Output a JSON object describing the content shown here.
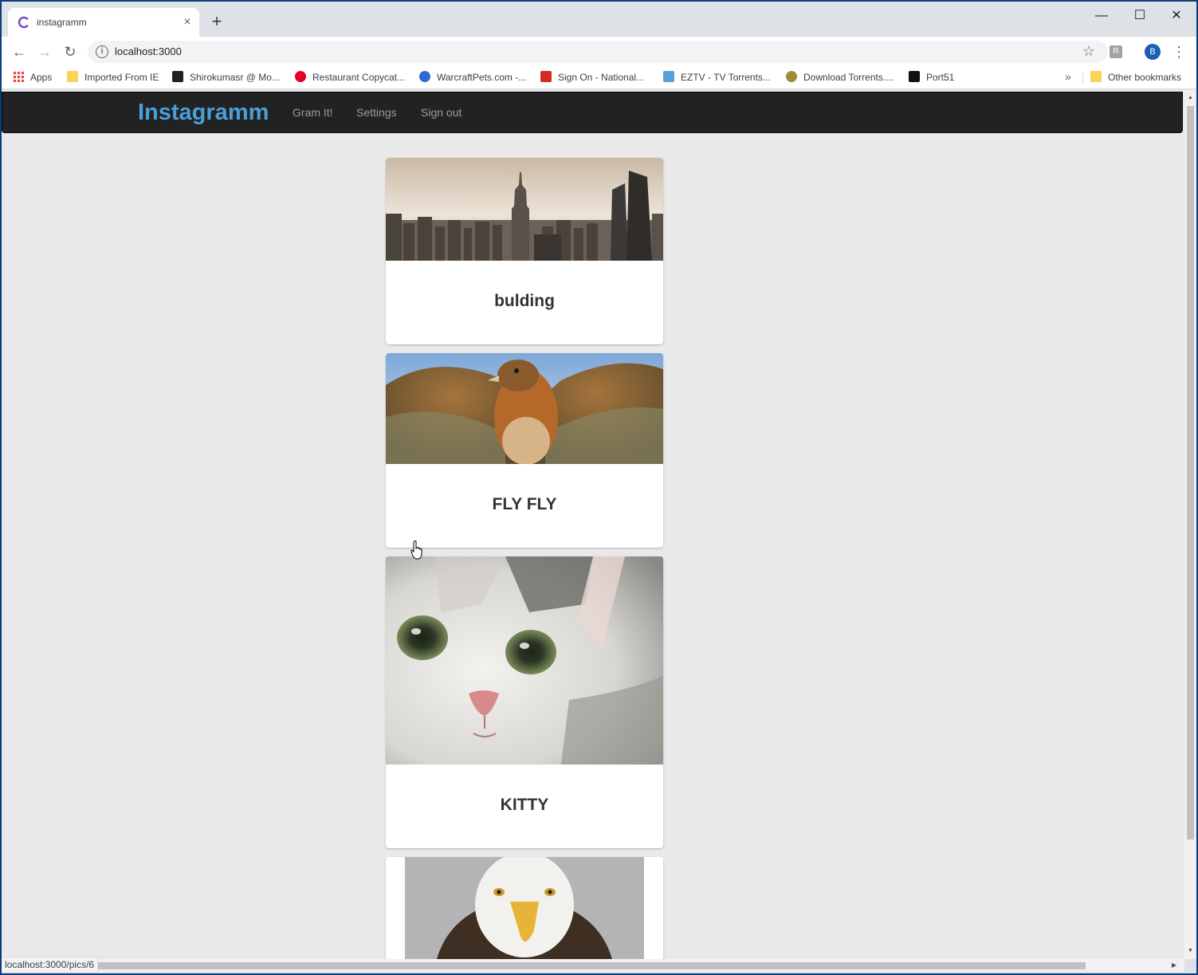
{
  "browser": {
    "tab_title": "instagramm",
    "new_tab": "+",
    "close_tab": "×",
    "window_controls": {
      "minimize": "—",
      "maximize": "☐",
      "close": "✕"
    },
    "nav": {
      "back": "←",
      "forward": "→",
      "reload": "↻"
    },
    "url": "localhost:3000",
    "info": "i",
    "star": "☆",
    "extension": "R",
    "profile_initial": "B",
    "menu": "⋮",
    "bookmarks": [
      {
        "label": "Apps"
      },
      {
        "label": "Imported From IE"
      },
      {
        "label": "Shirokumasr @ Mo..."
      },
      {
        "label": "Restaurant Copycat..."
      },
      {
        "label": "WarcraftPets.com -..."
      },
      {
        "label": "Sign On - National..."
      },
      {
        "label": "EZTV - TV Torrents..."
      },
      {
        "label": "Download Torrents...."
      },
      {
        "label": "Port51"
      }
    ],
    "bookmarks_more": "»",
    "other_bookmarks": "Other bookmarks",
    "status_url": "localhost:3000/pics/6"
  },
  "app": {
    "brand": "Instagramm",
    "nav_links": [
      "Gram It!",
      "Settings",
      "Sign out"
    ],
    "posts": [
      {
        "title": "bulding",
        "image": "city-skyline-photo"
      },
      {
        "title": "FLY FLY",
        "image": "hawk-photo"
      },
      {
        "title": "KITTY",
        "image": "kitten-photo"
      },
      {
        "title": "",
        "image": "bald-eagle-photo"
      }
    ]
  },
  "colors": {
    "navbar_bg": "#222222",
    "brand": "#4a9fd8",
    "nav_link": "#9d9d9d",
    "page_bg": "#e9e9e9",
    "card_bg": "#ffffff",
    "title": "#333333"
  }
}
